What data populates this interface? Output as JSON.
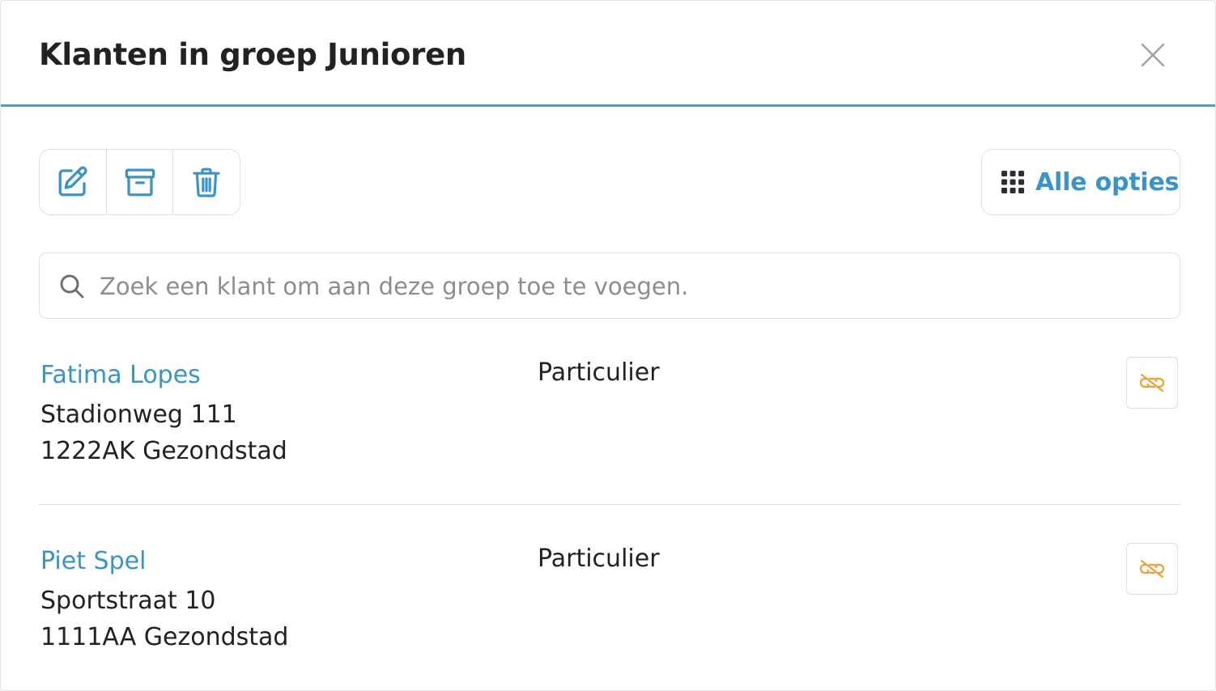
{
  "dialog": {
    "title": "Klanten in groep Junioren"
  },
  "toolbar": {
    "buttons": [
      {
        "icon": "edit-icon"
      },
      {
        "icon": "archive-icon"
      },
      {
        "icon": "trash-icon"
      }
    ],
    "options_label": "Alle opties",
    "options_icon": "grid-icon"
  },
  "search": {
    "placeholder": "Zoek een klant om aan deze groep toe te voegen.",
    "value": ""
  },
  "clients": [
    {
      "name": "Fatima Lopes",
      "street": "Stadionweg 111",
      "city": "1222AK Gezondstad",
      "type": "Particulier",
      "action_icon": "unlink-icon"
    },
    {
      "name": "Piet Spel",
      "street": "Sportstraat 10",
      "city": "1111AA Gezondstad",
      "type": "Particulier",
      "action_icon": "unlink-icon"
    }
  ],
  "colors": {
    "accent": "#3a93c9",
    "header_border": "#4a9fcf",
    "unlink": "#f0a030",
    "border": "#dcdfe3"
  }
}
